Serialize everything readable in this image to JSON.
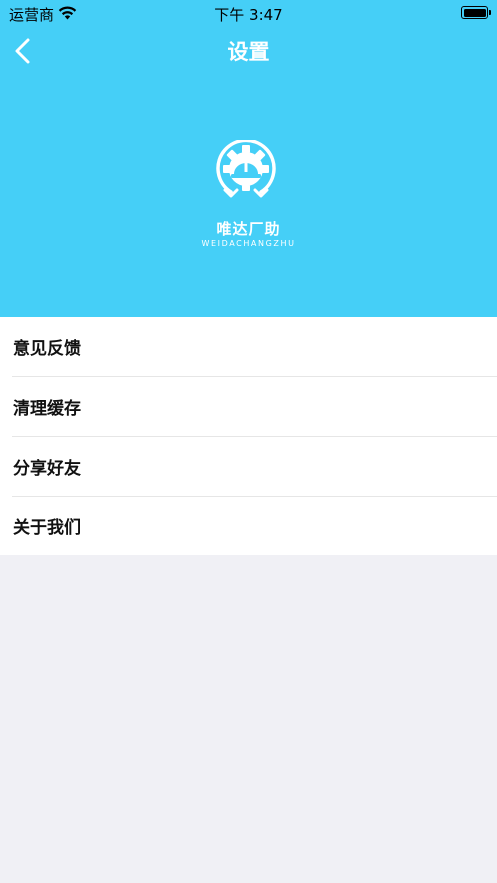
{
  "status_bar": {
    "carrier": "运营商",
    "time": "下午 3:47"
  },
  "nav": {
    "title": "设置",
    "back_icon": "chevron-left-icon"
  },
  "brand": {
    "name": "唯达厂助",
    "subtitle": "WEIDACHANGZHU",
    "logo_icon": "gear-hardhat-wrench-logo"
  },
  "menu": {
    "items": [
      {
        "label": "意见反馈"
      },
      {
        "label": "清理缓存"
      },
      {
        "label": "分享好友"
      },
      {
        "label": "关于我们"
      }
    ]
  },
  "colors": {
    "header_bg": "#45cff7",
    "page_bg": "#f0f0f5",
    "menu_bg": "#ffffff"
  }
}
